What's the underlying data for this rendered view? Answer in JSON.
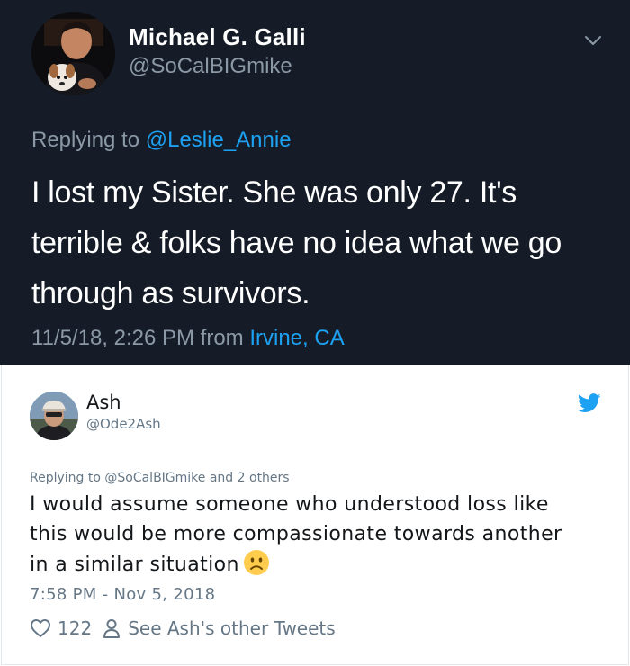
{
  "original_tweet": {
    "author_name": "Michael G. Galli",
    "author_handle": "@SoCalBIGmike",
    "replying_prefix": "Replying to ",
    "replying_handle": "@Leslie_Annie",
    "text_lines": [
      "I lost my Sister. She was only 27. It's",
      "terrible & folks have no idea what we go",
      "through as survivors."
    ],
    "timestamp": "11/5/18, 2:26 PM from ",
    "location": "Irvine, CA",
    "icons": {
      "menu": "chevron-down-icon",
      "avatar": "avatar-photo"
    },
    "colors": {
      "background": "#151c27",
      "link": "#1da1f2",
      "muted": "#8b98a5"
    }
  },
  "reply_tweet": {
    "author_name": "Ash",
    "author_handle": "@Ode2Ash",
    "replying_text": "Replying to @SoCalBIGmike and 2 others",
    "text_lines": [
      "I would assume someone who understood loss like",
      "this would be more compassionate towards another",
      "in a similar situation"
    ],
    "emoji": "slightly-frowning-face",
    "timestamp": "7:58 PM - Nov 5, 2018",
    "like_count": "122",
    "other_tweets_label": "See Ash's other Tweets",
    "icons": {
      "brand": "twitter-bird-icon",
      "like": "heart-icon",
      "profile": "person-icon"
    },
    "colors": {
      "brand": "#1da1f2",
      "muted": "#657786",
      "text": "#14171a"
    }
  }
}
